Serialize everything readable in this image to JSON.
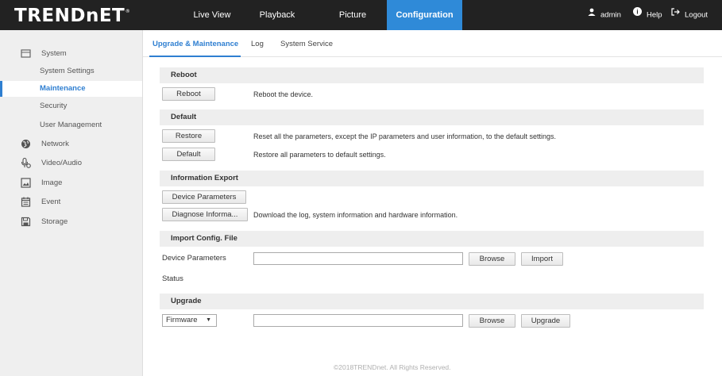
{
  "header": {
    "logo": "TRENDnET",
    "logo_mark": "®",
    "tabs": [
      {
        "label": "Live View"
      },
      {
        "label": "Playback"
      },
      {
        "label": "Picture"
      },
      {
        "label": "Configuration"
      }
    ],
    "user": "admin",
    "help": "Help",
    "logout": "Logout"
  },
  "sidebar": {
    "items": [
      {
        "label": "System",
        "icon": "monitor-icon"
      },
      {
        "label": "System Settings"
      },
      {
        "label": "Maintenance"
      },
      {
        "label": "Security"
      },
      {
        "label": "User Management"
      },
      {
        "label": "Network",
        "icon": "globe-icon"
      },
      {
        "label": "Video/Audio",
        "icon": "microphone-icon"
      },
      {
        "label": "Image",
        "icon": "image-icon"
      },
      {
        "label": "Event",
        "icon": "calendar-icon"
      },
      {
        "label": "Storage",
        "icon": "disk-icon"
      }
    ]
  },
  "subtabs": [
    "Upgrade & Maintenance",
    "Log",
    "System Service"
  ],
  "reboot": {
    "title": "Reboot",
    "button": "Reboot",
    "desc": "Reboot the device."
  },
  "default": {
    "title": "Default",
    "restore_button": "Restore",
    "restore_desc": "Reset all the parameters, except the IP parameters and user information, to the default settings.",
    "default_button": "Default",
    "default_desc": "Restore all parameters to default settings."
  },
  "export": {
    "title": "Information Export",
    "device_button": "Device Parameters",
    "diagnose_button": "Diagnose Informa...",
    "diagnose_desc": "Download the log, system information and hardware information."
  },
  "import": {
    "title": "Import Config. File",
    "label": "Device Parameters",
    "browse": "Browse",
    "import_button": "Import",
    "status_label": "Status"
  },
  "upgrade": {
    "title": "Upgrade",
    "select_value": "Firmware",
    "browse": "Browse",
    "upgrade_button": "Upgrade"
  },
  "footer": "©2018TRENDnet. All Rights Reserved.",
  "colors": {
    "accent": "#2f8ad8",
    "topbar": "#222222",
    "sidebar": "#efefef"
  }
}
